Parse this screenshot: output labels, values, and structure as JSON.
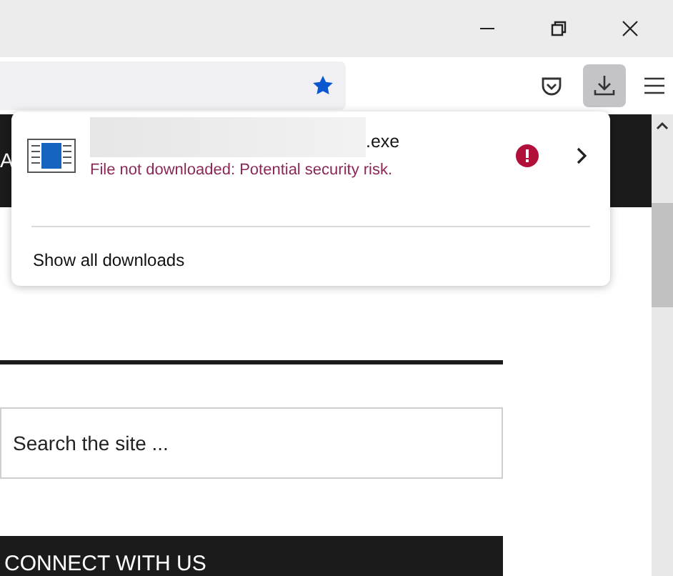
{
  "window": {
    "controls": [
      {
        "kind": "minimize"
      },
      {
        "kind": "restore"
      },
      {
        "kind": "close"
      }
    ]
  },
  "toolbar": {
    "bookmarked": true,
    "downloads_open": true
  },
  "downloads_panel": {
    "items": [
      {
        "filename": ".exe",
        "status": "File not downloaded: Potential security risk.",
        "blocked": true
      }
    ],
    "footer": "Show all downloads"
  },
  "page": {
    "header_text": "A",
    "search": {
      "placeholder": "Search the site ..."
    },
    "section_title": "CONNECT WITH US"
  }
}
